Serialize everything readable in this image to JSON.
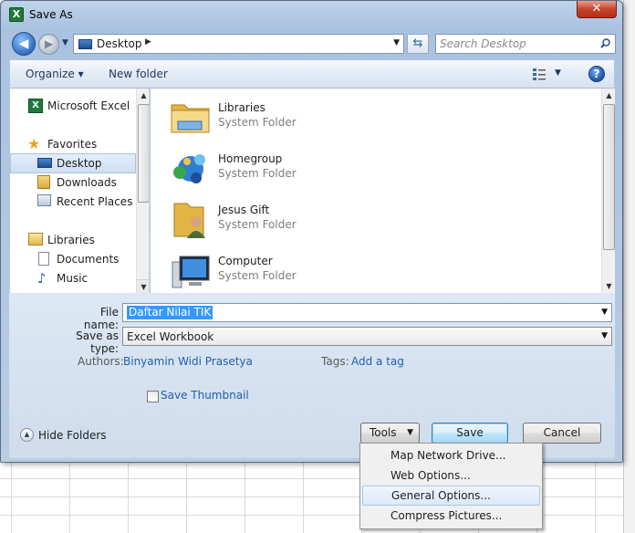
{
  "dialog": {
    "title": "Save As",
    "app_icon_letter": "X",
    "close_glyph": "✕"
  },
  "address": {
    "location": "Desktop",
    "search_placeholder": "Search Desktop"
  },
  "toolbar": {
    "organize_label": "Organize ▾",
    "new_folder_label": "New folder",
    "help_glyph": "?"
  },
  "nav": {
    "items": [
      {
        "label": "Microsoft Excel",
        "icon": "excel-icon"
      },
      {
        "label": "Favorites",
        "icon": "star-icon"
      },
      {
        "label": "Desktop",
        "icon": "desktop-icon",
        "selected": true
      },
      {
        "label": "Downloads",
        "icon": "downloads-icon"
      },
      {
        "label": "Recent Places",
        "icon": "recent-places-icon"
      },
      {
        "label": "Libraries",
        "icon": "libraries-icon"
      },
      {
        "label": "Documents",
        "icon": "documents-icon"
      },
      {
        "label": "Music",
        "icon": "music-icon"
      }
    ]
  },
  "files": [
    {
      "name": "Libraries",
      "type": "System Folder",
      "icon": "libraries-folder-icon"
    },
    {
      "name": "Homegroup",
      "type": "System Folder",
      "icon": "homegroup-icon"
    },
    {
      "name": "Jesus Gift",
      "type": "System Folder",
      "icon": "user-folder-icon"
    },
    {
      "name": "Computer",
      "type": "System Folder",
      "icon": "computer-icon"
    }
  ],
  "form": {
    "filename_label": "File name:",
    "filename_value": "Daftar Nilai TIK",
    "savetype_label": "Save as type:",
    "savetype_value": "Excel Workbook",
    "authors_label": "Authors:",
    "authors_value": "Binyamin Widi Prasetya",
    "tags_label": "Tags:",
    "tags_value": "Add a tag",
    "thumbnail_label": "Save Thumbnail",
    "thumbnail_checked": false,
    "hide_folders_label": "Hide Folders"
  },
  "buttons": {
    "tools_label": "Tools",
    "save_label": "Save",
    "cancel_label": "Cancel"
  },
  "tools_menu": {
    "items": [
      "Map Network Drive...",
      "Web Options...",
      "General Options...",
      "Compress Pictures..."
    ],
    "highlighted": "General Options..."
  }
}
